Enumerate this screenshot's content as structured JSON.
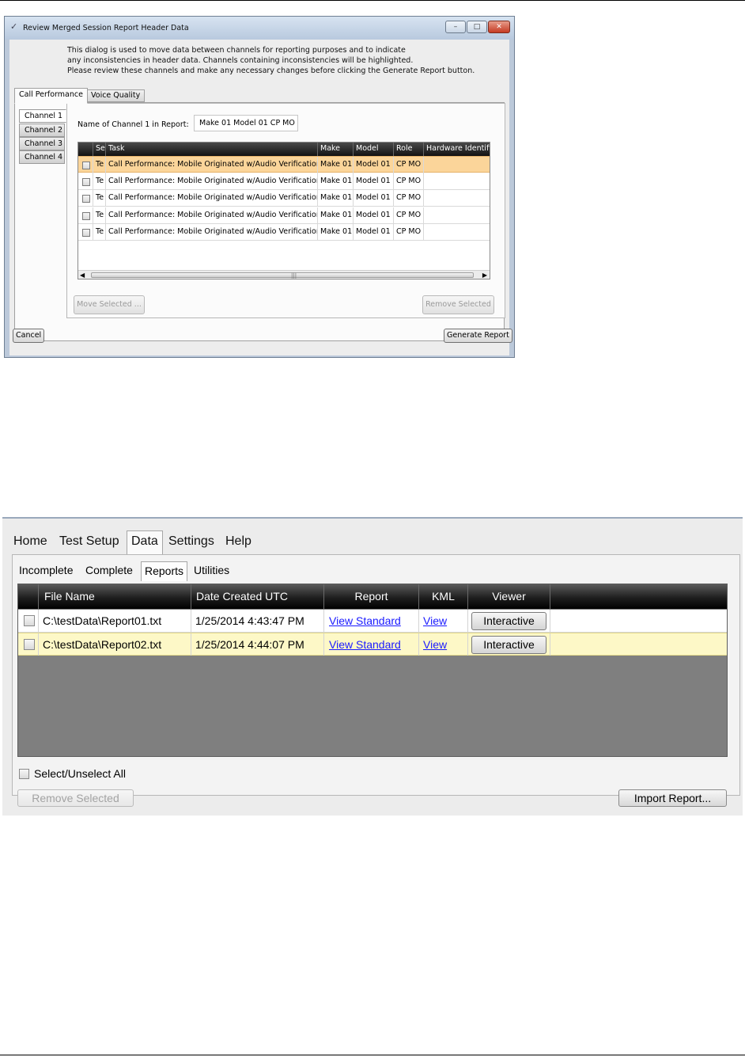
{
  "dialog": {
    "title": "Review Merged Session Report Header Data",
    "window_controls": {
      "minimize": "–",
      "maximize": "□",
      "close": "✕"
    },
    "intro_lines": [
      "This dialog is used to move data between channels for reporting purposes and to indicate",
      "any inconsistencies in header data. Channels containing inconsistencies will be highlighted.",
      "Please review these channels and make any necessary changes before clicking the Generate Report button."
    ],
    "tabs": [
      "Call Performance",
      "Voice Quality"
    ],
    "channel_tabs": [
      "Channel 1",
      "Channel 2",
      "Channel 3",
      "Channel 4"
    ],
    "name_label": "Name of Channel 1 in Report:",
    "name_value": "Make 01 Model 01 CP MO",
    "grid": {
      "columns": [
        "",
        "Se",
        "Task",
        "Make",
        "Model",
        "Role",
        "Hardware Identifi"
      ],
      "rows": [
        {
          "se": "Te",
          "task": "Call Performance: Mobile Originated w/Audio Verification",
          "make": "Make 01",
          "model": "Model 01",
          "role": "CP MO",
          "hw": "",
          "selected": true
        },
        {
          "se": "Te",
          "task": "Call Performance: Mobile Originated w/Audio Verification",
          "make": "Make 01",
          "model": "Model 01",
          "role": "CP MO",
          "hw": "",
          "selected": false
        },
        {
          "se": "Te",
          "task": "Call Performance: Mobile Originated w/Audio Verification",
          "make": "Make 01",
          "model": "Model 01",
          "role": "CP MO",
          "hw": "",
          "selected": false
        },
        {
          "se": "Te",
          "task": "Call Performance: Mobile Originated w/Audio Verification",
          "make": "Make 01",
          "model": "Model 01",
          "role": "CP MO",
          "hw": "",
          "selected": false
        },
        {
          "se": "Te",
          "task": "Call Performance: Mobile Originated w/Audio Verification",
          "make": "Make 01",
          "model": "Model 01",
          "role": "CP MO",
          "hw": "",
          "selected": false
        }
      ],
      "scroll_left": "◀",
      "scroll_right": "▶",
      "scroll_grip": "|||"
    },
    "move_selected_label": "Move Selected ...",
    "remove_selected_label": "Remove Selected",
    "cancel_label": "Cancel",
    "generate_label": "Generate Report"
  },
  "app": {
    "menu": [
      "Home",
      "Test Setup",
      "Data",
      "Settings",
      "Help"
    ],
    "active_menu": "Data",
    "sub_tabs": [
      "Incomplete",
      "Complete",
      "Reports",
      "Utilities"
    ],
    "active_sub_tab": "Reports",
    "grid": {
      "columns": [
        "",
        "File Name",
        "Date Created UTC",
        "Report",
        "KML",
        "Viewer",
        ""
      ],
      "rows": [
        {
          "file": "C:\\testData\\Report01.txt",
          "date": "1/25/2014 4:43:47 PM",
          "report": "View Standard",
          "kml": "View",
          "viewer": "Interactive",
          "selected": false
        },
        {
          "file": "C:\\testData\\Report02.txt",
          "date": "1/25/2014 4:44:07 PM",
          "report": "View Standard",
          "kml": "View",
          "viewer": "Interactive",
          "selected": true
        }
      ]
    },
    "select_all_label": "Select/Unselect All",
    "remove_selected_label": "Remove Selected",
    "import_label": "Import Report..."
  }
}
